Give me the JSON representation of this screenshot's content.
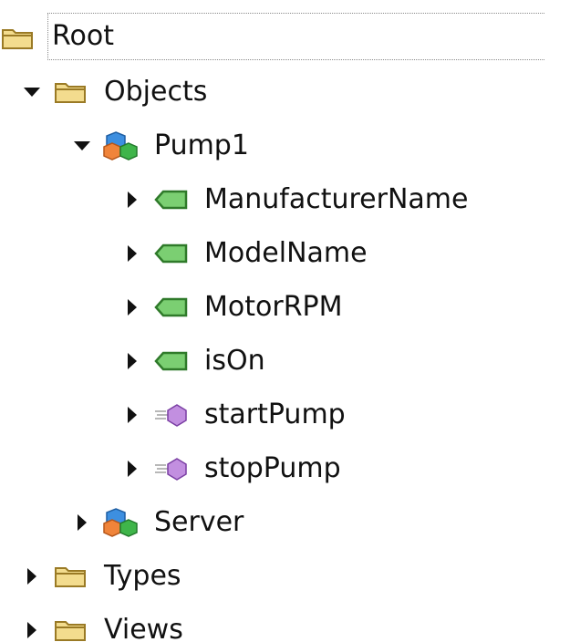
{
  "tree": {
    "root": {
      "label": "Root",
      "icon": "folder-icon",
      "selected": true
    },
    "objects": {
      "label": "Objects",
      "icon": "folder-icon",
      "state": "expanded"
    },
    "pump1": {
      "label": "Pump1",
      "icon": "object-icon",
      "state": "expanded"
    },
    "pump1_children": [
      {
        "label": "ManufacturerName",
        "icon": "variable-tag-icon",
        "state": "collapsed"
      },
      {
        "label": "ModelName",
        "icon": "variable-tag-icon",
        "state": "collapsed"
      },
      {
        "label": "MotorRPM",
        "icon": "variable-tag-icon",
        "state": "collapsed"
      },
      {
        "label": "isOn",
        "icon": "variable-tag-icon",
        "state": "collapsed"
      },
      {
        "label": "startPump",
        "icon": "method-icon",
        "state": "collapsed"
      },
      {
        "label": "stopPump",
        "icon": "method-icon",
        "state": "collapsed"
      }
    ],
    "server": {
      "label": "Server",
      "icon": "object-icon",
      "state": "collapsed"
    },
    "types": {
      "label": "Types",
      "icon": "folder-icon",
      "state": "collapsed"
    },
    "views": {
      "label": "Views",
      "icon": "folder-icon",
      "state": "collapsed"
    }
  },
  "colors": {
    "folder_fill": "#f3dc8e",
    "folder_stroke": "#9a7a25",
    "tag_fill": "#7bcf72",
    "tag_stroke": "#2f7a2a",
    "method_fill": "#c28fe0",
    "cube_blue": "#3d8fe0",
    "cube_orange": "#f0843a",
    "cube_green": "#3fb54a"
  }
}
